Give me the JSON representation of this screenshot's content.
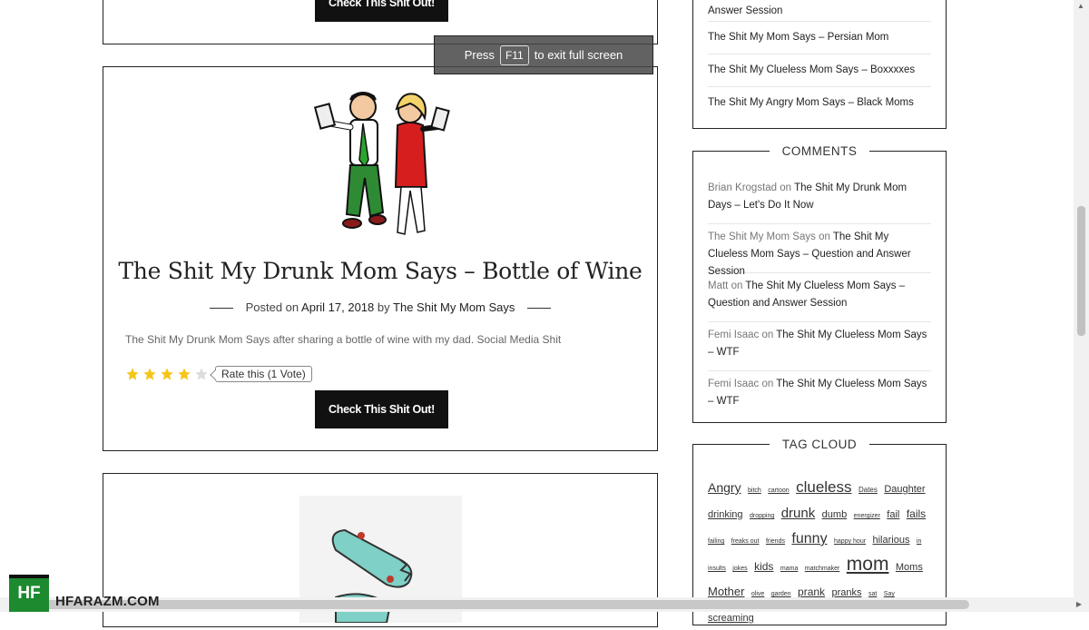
{
  "fullscreen_notice": {
    "prefix": "Press",
    "key": "F11",
    "suffix": "to exit full screen"
  },
  "top_card": {
    "cta_label": "Check This Shit Out!"
  },
  "main_post": {
    "title": "The Shit My Drunk Mom Says – Bottle of Wine",
    "posted_on_label": "Posted on",
    "date": "April 17, 2018",
    "by_label": "by",
    "author": "The Shit My Mom Says",
    "excerpt": "The Shit My Drunk Mom Says after sharing a bottle of wine with my dad. Social Media Shit",
    "rating": {
      "stars_filled": 4,
      "stars_total": 5,
      "label": "Rate this (1 Vote)"
    },
    "cta_label": "Check This Shit Out!"
  },
  "sidebar": {
    "recent_posts": [
      "Answer Session",
      "The Shit My Mom Says – Persian Mom",
      "The Shit My Clueless Mom Says – Boxxxxes",
      "The Shit My Angry Mom Says – Black Moms"
    ],
    "comments_title": "COMMENTS",
    "comments": [
      {
        "author": "Brian Krogstad",
        "on": "on",
        "post": "The Shit My Drunk Mom Days – Let's Do It Now"
      },
      {
        "author": "The Shit My Mom Says",
        "on": "on",
        "post": "The Shit My Clueless Mom Says – Question and Answer Session"
      },
      {
        "author": "Matt",
        "on": "on",
        "post": "The Shit My Clueless Mom Says – Question and Answer Session"
      },
      {
        "author": "Femi Isaac",
        "on": "on",
        "post": "The Shit My Clueless Mom Says – WTF"
      },
      {
        "author": "Femi Isaac",
        "on": "on",
        "post": "The Shit My Clueless Mom Says – WTF"
      }
    ],
    "tag_cloud_title": "TAG CLOUD",
    "tags": [
      {
        "label": "Angry",
        "size": 14
      },
      {
        "label": "bitch",
        "size": 7
      },
      {
        "label": "cartoon",
        "size": 7
      },
      {
        "label": "clueless",
        "size": 17
      },
      {
        "label": "Dates",
        "size": 8
      },
      {
        "label": "Daughter",
        "size": 11
      },
      {
        "label": "drinking",
        "size": 11
      },
      {
        "label": "dropping",
        "size": 7
      },
      {
        "label": "drunk",
        "size": 15
      },
      {
        "label": "dumb",
        "size": 11
      },
      {
        "label": "energizer",
        "size": 7
      },
      {
        "label": "fail",
        "size": 11
      },
      {
        "label": "fails",
        "size": 12
      },
      {
        "label": "failing",
        "size": 7
      },
      {
        "label": "freaks out",
        "size": 7
      },
      {
        "label": "friends",
        "size": 7
      },
      {
        "label": "funny",
        "size": 16
      },
      {
        "label": "happy hour",
        "size": 7
      },
      {
        "label": "hilarious",
        "size": 11
      },
      {
        "label": "in",
        "size": 7
      },
      {
        "label": "insults",
        "size": 7
      },
      {
        "label": "jokes",
        "size": 7
      },
      {
        "label": "kids",
        "size": 12
      },
      {
        "label": "mama",
        "size": 7
      },
      {
        "label": "matchmaker",
        "size": 7
      },
      {
        "label": "mom",
        "size": 21
      },
      {
        "label": "Moms",
        "size": 11
      },
      {
        "label": "Mother",
        "size": 13
      },
      {
        "label": "olive",
        "size": 7
      },
      {
        "label": "garden",
        "size": 7
      },
      {
        "label": "prank",
        "size": 12
      },
      {
        "label": "pranks",
        "size": 11
      },
      {
        "label": "sat",
        "size": 7
      },
      {
        "label": "Say",
        "size": 7
      },
      {
        "label": "screaming",
        "size": 11
      }
    ]
  },
  "watermark": {
    "logo": "HF",
    "site": "HFARAZM.COM"
  },
  "colors": {
    "accent_green": "#1d8a30",
    "star_gold": "#f5c518",
    "button_black": "#111111"
  }
}
